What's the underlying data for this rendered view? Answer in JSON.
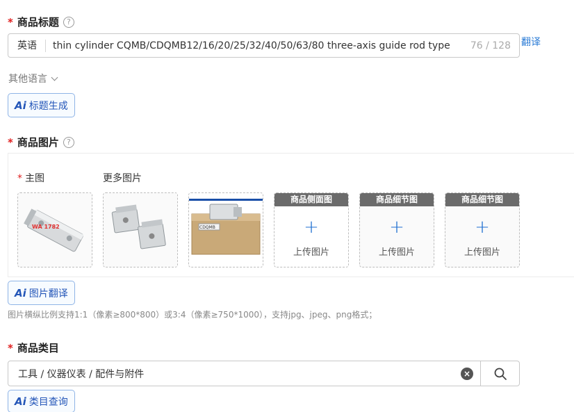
{
  "title_section": {
    "required": "*",
    "label": "商品标题",
    "help": "?",
    "language": "英语",
    "value": "thin cylinder CQMB/CDQMB12/16/20/25/32/40/50/63/80 three-axis guide rod type",
    "count": "76 / 128",
    "translate_link": "翻译",
    "other_languages": "其他语言",
    "ai_label": "Ai",
    "ai_button": "标题生成"
  },
  "image_section": {
    "required": "*",
    "label": "商品图片",
    "help": "?",
    "main_label": "主图",
    "more_label": "更多图片",
    "watermark": "WA 1782",
    "box_label": "CDQMB",
    "slots": [
      {
        "header": "商品侧面图",
        "plus": "+",
        "text": "上传图片"
      },
      {
        "header": "商品细节图",
        "plus": "+",
        "text": "上传图片"
      },
      {
        "header": "商品细节图",
        "plus": "+",
        "text": "上传图片"
      }
    ],
    "ai_label": "Ai",
    "ai_button": "图片翻译",
    "hint": "图片横纵比例支持1:1（像素≥800*800）或3:4（像素≥750*1000），支持jpg、jpeg、png格式；"
  },
  "category_section": {
    "required": "*",
    "label": "商品类目",
    "value": "工具 / 仪器仪表 / 配件与附件",
    "clear": "×",
    "ai_label": "Ai",
    "ai_button": "类目查询"
  },
  "colors": {
    "accent": "#2a7bd6",
    "required": "#e02020",
    "ai_text": "#2456b8",
    "ai_border": "#8fb4e6"
  }
}
